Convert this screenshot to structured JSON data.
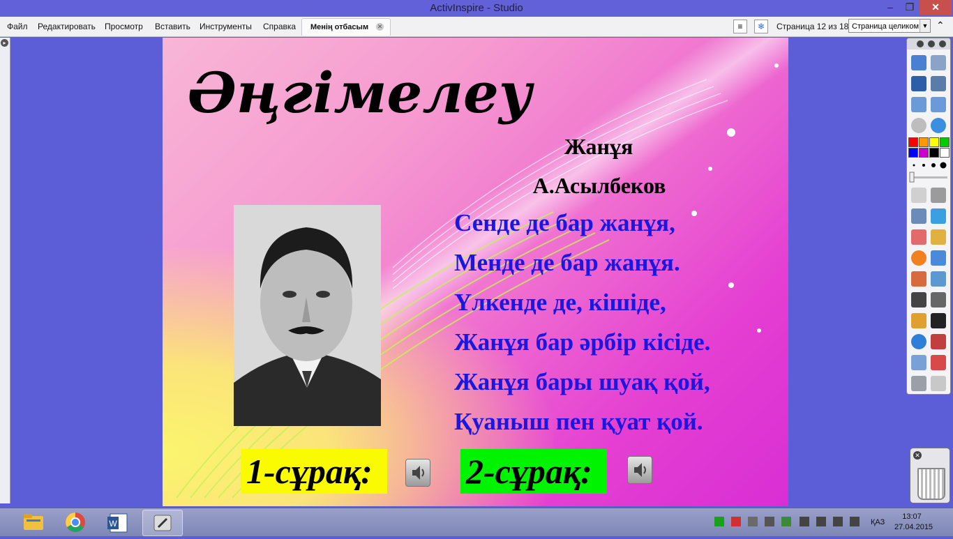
{
  "window": {
    "title": "ActivInspire - Studio",
    "min": "–",
    "max": "❐",
    "close": "✕"
  },
  "menu": [
    "Файл",
    "Редактировать",
    "Просмотр",
    "Вставить",
    "Инструменты",
    "Справка"
  ],
  "tab": {
    "label": "Менің отбасым",
    "close": "✕"
  },
  "page": {
    "indicator": "Страница 12 из 18",
    "zoom": "Страница целиком"
  },
  "slide": {
    "heading": "Әңгімелеу",
    "poem_title": "Жанұя",
    "poem_author": "А.Асылбеков",
    "poem_lines": [
      "Сенде де бар жанұя,",
      "Менде де бар жанұя.",
      "Үлкенде де, кішіде,",
      "Жанұя бар әрбір кісіде.",
      "Жанұя бары шуақ қой,",
      "Қуаныш пен қуат қой."
    ],
    "question1": "1-сұрақ:",
    "question2": "2-сұрақ:"
  },
  "toolbox_colors": [
    "#ff0000",
    "#ff9900",
    "#ffff00",
    "#00cc00",
    "#0000ff",
    "#cc00cc",
    "#000000",
    "#ffffff"
  ],
  "taskbar": {
    "apps": [
      "file-explorer",
      "chrome",
      "word",
      "activinspire"
    ],
    "lang": "ҚАЗ",
    "time": "13:07",
    "date": "27.04.2015"
  }
}
